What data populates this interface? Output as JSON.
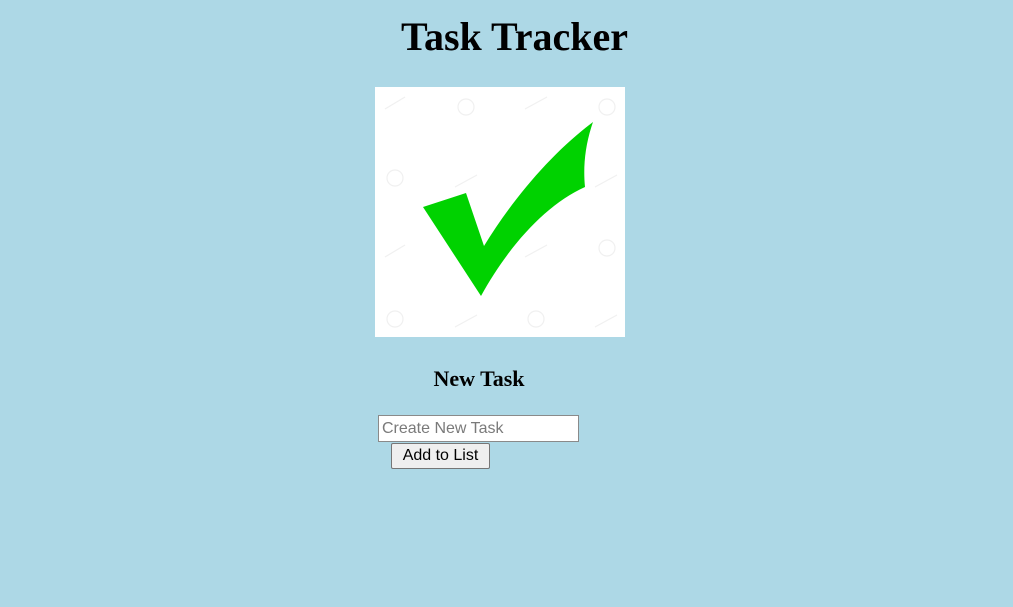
{
  "app": {
    "title": "Task Tracker",
    "background_color": "#add8e6"
  },
  "hero": {
    "icon": "checkmark-icon",
    "check_color": "#00d200",
    "background_color": "#ffffff"
  },
  "form": {
    "heading": "New Task",
    "input_placeholder": "Create New Task",
    "input_value": "",
    "submit_label": "Add to List"
  }
}
